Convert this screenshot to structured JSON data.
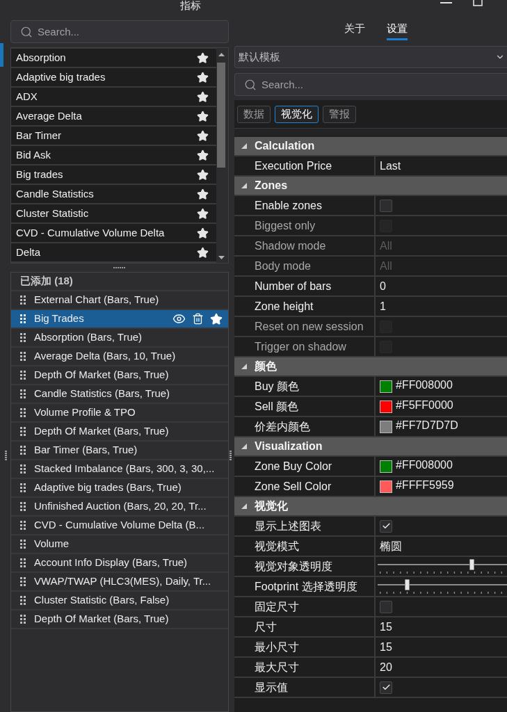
{
  "window": {
    "title": "指标"
  },
  "indicator_search": {
    "placeholder": "Search..."
  },
  "indicators": [
    "Absorption",
    "Adaptive big trades",
    "ADX",
    "Average Delta",
    "Bar Timer",
    "Bid Ask",
    "Big trades",
    "Candle Statistics",
    "Cluster Statistic",
    "CVD - Cumulative Volume Delta",
    "Delta"
  ],
  "added": {
    "title": "已添加 (18)",
    "items": [
      {
        "name": "External Chart (Bars, True)",
        "selected": false
      },
      {
        "name": "Big Trades",
        "selected": true
      },
      {
        "name": "Absorption (Bars, True)",
        "selected": false
      },
      {
        "name": "Average Delta (Bars, 10, True)",
        "selected": false
      },
      {
        "name": "Depth Of Market (Bars, True)",
        "selected": false
      },
      {
        "name": "Candle Statistics (Bars, True)",
        "selected": false
      },
      {
        "name": "Volume Profile & TPO",
        "selected": false
      },
      {
        "name": "Depth Of Market (Bars, True)",
        "selected": false
      },
      {
        "name": "Bar Timer (Bars, True)",
        "selected": false
      },
      {
        "name": "Stacked Imbalance (Bars, 300, 3, 30,...",
        "selected": false
      },
      {
        "name": "Adaptive big trades (Bars, True)",
        "selected": false
      },
      {
        "name": "Unfinished Auction (Bars, 20, 20, Tr...",
        "selected": false
      },
      {
        "name": "CVD - Cumulative Volume Delta (B...",
        "selected": false
      },
      {
        "name": "Volume",
        "selected": false
      },
      {
        "name": "Account Info Display (Bars, True)",
        "selected": false
      },
      {
        "name": "VWAP/TWAP (HLC3(MES), Daily, Tr...",
        "selected": false
      },
      {
        "name": "Cluster Statistic (Bars, False)",
        "selected": false
      },
      {
        "name": "Depth Of Market (Bars, True)",
        "selected": false
      }
    ]
  },
  "tabs": [
    {
      "label": "关于",
      "selected": false
    },
    {
      "label": "设置",
      "selected": true
    }
  ],
  "template": {
    "value": "默认模板"
  },
  "property_search": {
    "placeholder": "Search..."
  },
  "sub_tabs": [
    {
      "label": "数据",
      "selected": false
    },
    {
      "label": "视觉化",
      "selected": true
    },
    {
      "label": "警报",
      "selected": false
    }
  ],
  "categories": [
    {
      "title": "Calculation",
      "expanded": true,
      "properties": [
        {
          "label": "Execution Price",
          "kind": "text",
          "value": "Last",
          "disabled": false
        }
      ]
    },
    {
      "title": "Zones",
      "expanded": true,
      "properties": [
        {
          "label": "Enable zones",
          "kind": "checkbox",
          "checked": false,
          "disabled": false
        },
        {
          "label": "Biggest only",
          "kind": "checkbox",
          "checked": false,
          "disabled": true
        },
        {
          "label": "Shadow mode",
          "kind": "text",
          "value": "All",
          "disabled": true
        },
        {
          "label": "Body mode",
          "kind": "text",
          "value": "All",
          "disabled": true
        },
        {
          "label": "Number of bars",
          "kind": "text",
          "value": "0",
          "disabled": false
        },
        {
          "label": "Zone height",
          "kind": "text",
          "value": "1",
          "disabled": false
        },
        {
          "label": "Reset on new session",
          "kind": "checkbox",
          "checked": false,
          "disabled": true
        },
        {
          "label": "Trigger on shadow",
          "kind": "checkbox",
          "checked": false,
          "disabled": true
        }
      ]
    },
    {
      "title": "颜色",
      "expanded": true,
      "properties": [
        {
          "label": "Buy 颜色",
          "kind": "color",
          "color": "#008000",
          "value": "#FF008000",
          "disabled": false
        },
        {
          "label": "Sell 颜色",
          "kind": "color",
          "color": "#ff0000",
          "value": "#F5FF0000",
          "disabled": false
        },
        {
          "label": "价差内颜色",
          "kind": "color",
          "color": "#7d7d7d",
          "value": "#FF7D7D7D",
          "disabled": false
        }
      ]
    },
    {
      "title": "Visualization",
      "expanded": true,
      "properties": [
        {
          "label": "Zone Buy Color",
          "kind": "color",
          "color": "#008000",
          "value": "#FF008000",
          "disabled": false
        },
        {
          "label": "Zone Sell Color",
          "kind": "color",
          "color": "#ff5959",
          "value": "#FFFF5959",
          "disabled": false
        }
      ]
    },
    {
      "title": "视觉化",
      "expanded": true,
      "properties": [
        {
          "label": "显示上述图表",
          "kind": "checkbox",
          "checked": true,
          "disabled": false
        },
        {
          "label": "视觉模式",
          "kind": "text",
          "value": "椭圆",
          "disabled": false
        },
        {
          "label": "视觉对象透明度",
          "kind": "slider",
          "level": 0.74,
          "disabled": false
        },
        {
          "label": "Footprint 选择透明度",
          "kind": "slider",
          "level": 0.22,
          "disabled": false
        },
        {
          "label": "固定尺寸",
          "kind": "checkbox",
          "checked": false,
          "disabled": false
        },
        {
          "label": "尺寸",
          "kind": "text",
          "value": "15",
          "disabled": false
        },
        {
          "label": "最小尺寸",
          "kind": "text",
          "value": "15",
          "disabled": false
        },
        {
          "label": "最大尺寸",
          "kind": "text",
          "value": "20",
          "disabled": false
        },
        {
          "label": "显示值",
          "kind": "checkbox",
          "checked": true,
          "disabled": false
        }
      ]
    }
  ]
}
